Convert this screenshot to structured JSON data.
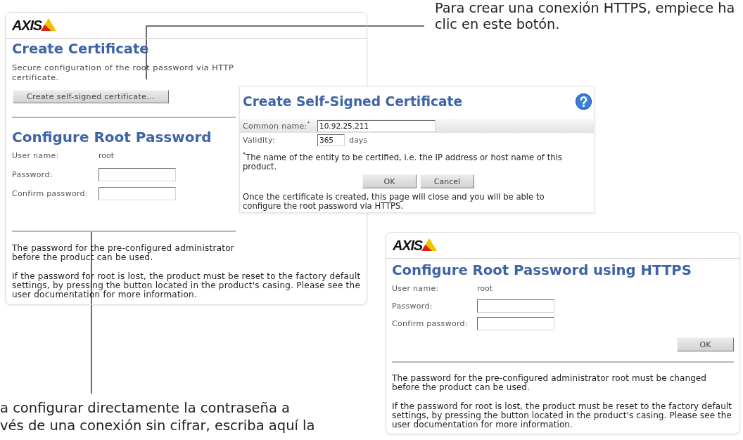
{
  "callouts": [
    {
      "lines": [
        "Para crear una conexión HTTPS, empiece ha",
        "clic en este botón."
      ]
    },
    {
      "lines": [
        "a configurar directamente la contraseña a",
        "vés de una conexión sin cifrar, escriba aquí la"
      ]
    }
  ],
  "certificate_page": {
    "logo": "AXIS",
    "certificate_title": "Create Certificate",
    "certificate_text": [
      "Secure configuration of the root password via HTTP",
      "certificate."
    ],
    "certificate_button": "Create self-signed certificate...",
    "password_title": "Configure Root Password",
    "fields": [
      {
        "kind": "text",
        "label": "User name:",
        "value": "root"
      },
      {
        "kind": "input",
        "label": "Password:"
      },
      {
        "kind": "input",
        "label": "Confirm password:"
      }
    ],
    "notes": [
      {
        "lines": [
          "The password for the pre-configured administrator",
          "before the product can be used."
        ]
      },
      {
        "lines": [
          "If the password for root is lost, the product must be reset to the factory default",
          "settings, by pressing the button located in the product's casing. Please see the",
          "user documentation for more information."
        ]
      }
    ]
  },
  "certificate_dialog": {
    "title": "Create Self-Signed Certificate",
    "fields": [
      {
        "kind": "text",
        "label": "Common name:$^{*}$",
        "value": "10.92.25.211",
        "highlighted": true
      },
      {
        "kind": "number",
        "label": "Validity:",
        "value": "365",
        "unit": "days",
        "highlighted": false
      }
    ],
    "footnote": [
      "$^{*}$The name of the entity to be certified, i.e. the IP address or host name of this",
      "product."
    ],
    "buttons": [
      "OK",
      "Cancel"
    ],
    "info": [
      "Once the certificate is created, this page will close and you will be able to",
      "configure the root password via HTTPS."
    ]
  },
  "https_page": {
    "logo": "AXIS",
    "title": "Configure Root Password using HTTPS",
    "fields": [
      {
        "kind": "text",
        "label": "User name:",
        "value": "root"
      },
      {
        "kind": "input",
        "label": "Password:"
      },
      {
        "kind": "input",
        "label": "Confirm password:"
      }
    ],
    "button": "OK",
    "notes": [
      {
        "lines": [
          "The password for the pre-configured administrator root must be changed",
          "before the product can be used."
        ]
      },
      {
        "lines": [
          "If the password for root is lost, the product must be reset to the factory default",
          "settings, by pressing the button located in the product's casing. Please see the",
          "user documentation for more information."
        ]
      }
    ]
  }
}
